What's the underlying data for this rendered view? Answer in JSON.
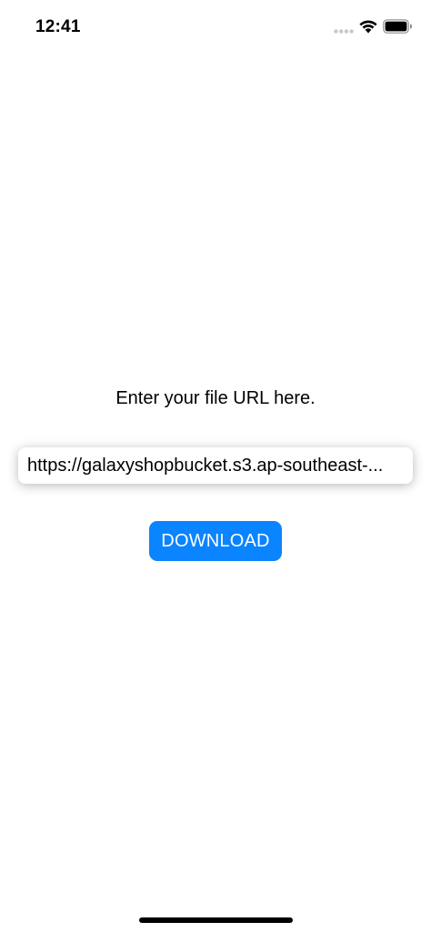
{
  "status_bar": {
    "time": "12:41",
    "icons": [
      "signal-dots-icon",
      "wifi-icon",
      "battery-icon"
    ]
  },
  "main": {
    "prompt": "Enter your file URL here.",
    "url_field_value": "https://galaxyshopbucket.s3.ap-southeast-...",
    "download_label": "DOWNLOAD"
  },
  "colors": {
    "accent": "#0a84ff",
    "background": "#ffffff",
    "text": "#000000"
  }
}
